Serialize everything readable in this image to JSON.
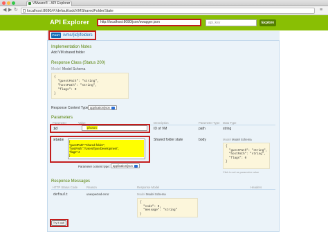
{
  "browser": {
    "tab_title": "VMware® - API Explorer",
    "tab_close": "×",
    "back": "◀",
    "forward": "▶",
    "reload": "↻",
    "url": "localhost:8080/#!/default/addVMSharedFolderState",
    "menu": "≡",
    "colors": {
      "close": "#fc605b",
      "minimize": "#fdbc40",
      "maximize": "#34c84a"
    }
  },
  "header": {
    "title": "API Explorer",
    "spec_url": "http://localhost:8080/json/swagger.json",
    "api_key_placeholder": "api_key",
    "explore_label": "Explore",
    "bg_color": "#89bf04"
  },
  "operation": {
    "method": "POST",
    "path": "/vms/{id}/folders",
    "implementation_notes_heading": "Implementation Notes",
    "implementation_notes": "Add VM shared folder",
    "response_class_heading": "Response Class (Status 200)",
    "model_link": "Model",
    "model_schema_link": "Model Schema",
    "response_schema": "{\n  \"guestPath\": \"string\",\n  \"hostPath\": \"string\",\n  \"flags\": 0\n}",
    "response_content_type_label": "Response Content Type",
    "response_content_type": "application/json"
  },
  "parameters": {
    "heading": "Parameters",
    "columns": [
      "Parameter",
      "Value",
      "Description",
      "Parameter Type",
      "Data Type"
    ],
    "id": {
      "name": "id",
      "value": "photon",
      "description": "ID of VM",
      "param_type": "path",
      "data_type": "string"
    },
    "state": {
      "name": "state",
      "value": "{\n\"guestPath\":\"shared-folder\",\n\"hostPath\":\"/Users/fpoe/Development\",\n\"flags\":4\n}",
      "description": "Shared folder state",
      "param_type": "body",
      "model_link": "Model",
      "model_schema_link": "Model Schema",
      "schema": "{\n  \"guestPath\": \"string\",\n  \"hostPath\": \"string\",\n  \"flags\": 0\n}",
      "click_hint": "Click to set as parameter value",
      "content_type_label": "Parameter content type:",
      "content_type": "application/json"
    }
  },
  "response_messages": {
    "heading": "Response Messages",
    "columns": [
      "HTTP Status Code",
      "Reason",
      "Response Model",
      "Headers"
    ],
    "rows": [
      {
        "code": "default",
        "reason": "unexpected error",
        "model_link": "Model",
        "model_schema_link": "Model Schema",
        "schema": "{\n  \"code\": 0,\n  \"message\": \"string\"\n}"
      }
    ]
  },
  "try_it_label": "Try it out!"
}
